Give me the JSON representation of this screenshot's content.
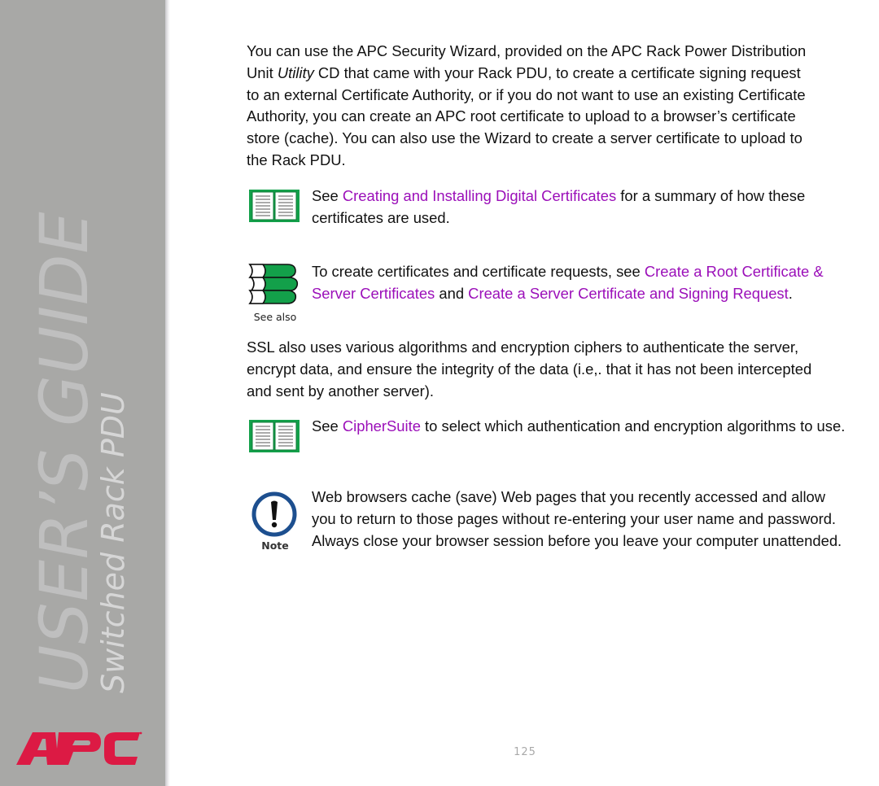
{
  "sidebar": {
    "guide_title": "USER’S GUIDE",
    "product_name": "Switched Rack PDU",
    "logo_text": "APC",
    "logo_icon": "apc-logo-icon",
    "colors": {
      "background": "#a8a8a6",
      "logo": "#dc1a44",
      "title": "#bfbfbf"
    }
  },
  "content": {
    "intro": {
      "part1": "You can use the APC Security Wizard, provided on the APC Rack Power Distribution Unit ",
      "italic": "Utility",
      "part2": " CD that came with your Rack PDU, to create a certificate signing request to an external Certificate Authority, or if you do not want to use an existing Certificate Authority, you can create an APC root certificate to upload to a browser’s certificate store (cache). You can also use the Wizard to create a server certificate to upload to the Rack PDU."
    },
    "ref1": {
      "icon": "open-book-icon",
      "pre": "See ",
      "link": "Creating and Installing Digital Certificates",
      "post": " for a summary of how these certificates are used."
    },
    "see_also": {
      "icon": "stacked-books-icon",
      "caption": "See also",
      "pre": "To create certificates and certificate requests, see ",
      "link1": "Create a Root Certificate & Server Certificates",
      "mid": " and ",
      "link2": "Create a Server Certificate and Signing Request",
      "post": "."
    },
    "ssl": "SSL also uses various algorithms and encryption ciphers to authenticate the server, encrypt data, and ensure the integrity of the data (i.e,. that it has not been intercepted and sent by another server).",
    "ref2": {
      "icon": "open-book-icon",
      "pre": "See ",
      "link": "CipherSuite",
      "post": " to select which authentication and encryption algorithms to use."
    },
    "note": {
      "icon": "exclamation-circle-icon",
      "caption": "Note",
      "text": "Web browsers cache (save) Web pages that you recently accessed and allow you to return to those pages without re-entering your user name and password. Always close your browser session before you leave your computer unattended."
    },
    "link_color": "#9b0fb9"
  },
  "footer": {
    "page_number": "125"
  }
}
